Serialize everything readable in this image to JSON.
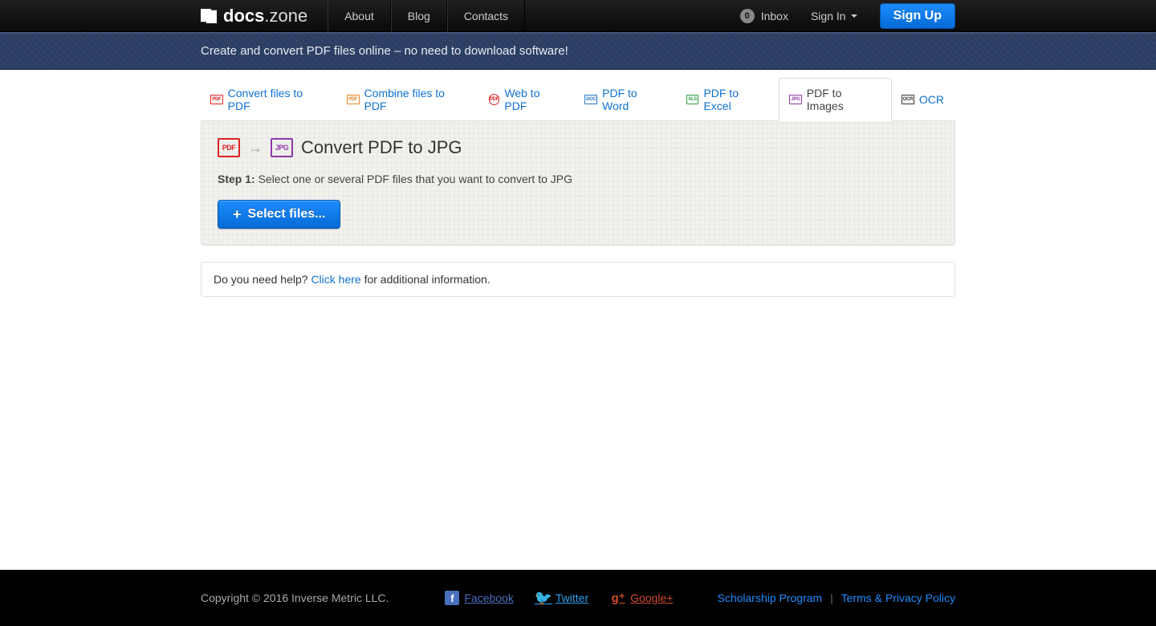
{
  "brand": {
    "bold": "docs",
    "thin": ".zone"
  },
  "nav": {
    "about": "About",
    "blog": "Blog",
    "contacts": "Contacts"
  },
  "header_right": {
    "inbox_count": "0",
    "inbox_label": "Inbox",
    "signin": "Sign In",
    "signup": "Sign Up"
  },
  "tagline": "Create and convert PDF files online – no need to download software!",
  "tabs": {
    "convert": "Convert files to PDF",
    "combine": "Combine files to PDF",
    "web": "Web to PDF",
    "word": "PDF to Word",
    "excel": "PDF to Excel",
    "images": "PDF to Images",
    "ocr": "OCR"
  },
  "panel": {
    "title": "Convert PDF to JPG",
    "stepLabel": "Step 1:",
    "stepText": "  Select one or several PDF files that you want to convert to JPG",
    "selectBtn": "Select files..."
  },
  "help": {
    "prefix": "Do you need help? ",
    "link": "Click here",
    "suffix": " for additional information."
  },
  "footer": {
    "copyright": "Copyright © 2016 Inverse Metric LLC.",
    "facebook": "Facebook",
    "twitter": "Twitter",
    "google": "Google+",
    "scholarship": "Scholarship Program",
    "sep": " | ",
    "terms": "Terms & Privacy Policy"
  }
}
